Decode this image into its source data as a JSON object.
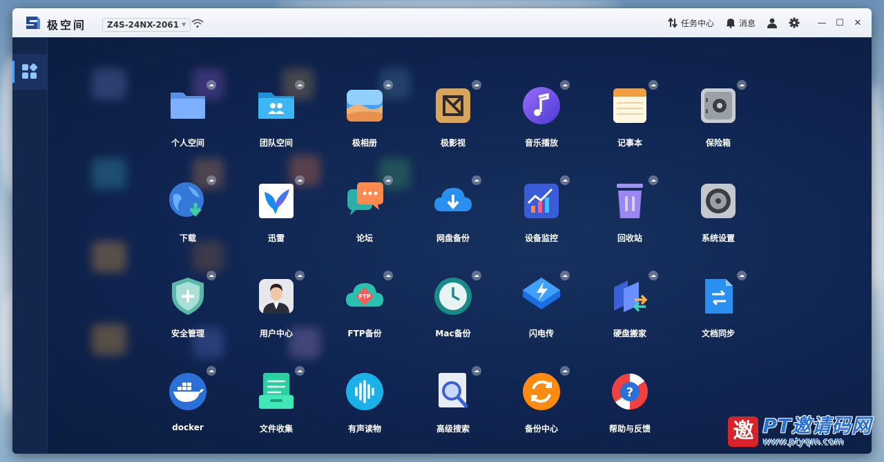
{
  "titlebar": {
    "app_name": "极空间",
    "device": "Z4S-24NX-2061",
    "task_center": "任务中心",
    "messages": "消息",
    "minimize": "—",
    "maximize": "☐",
    "close": "✕"
  },
  "apps": [
    {
      "label": "个人空间",
      "icon": "folder-icon"
    },
    {
      "label": "团队空间",
      "icon": "team-folder-icon"
    },
    {
      "label": "极相册",
      "icon": "photo-album-icon"
    },
    {
      "label": "极影视",
      "icon": "video-icon"
    },
    {
      "label": "音乐播放",
      "icon": "music-icon"
    },
    {
      "label": "记事本",
      "icon": "notepad-icon"
    },
    {
      "label": "保险箱",
      "icon": "safe-icon"
    },
    {
      "label": "下载",
      "icon": "download-icon"
    },
    {
      "label": "迅雷",
      "icon": "thunder-bird-icon"
    },
    {
      "label": "论坛",
      "icon": "forum-icon"
    },
    {
      "label": "网盘备份",
      "icon": "cloud-backup-icon"
    },
    {
      "label": "设备监控",
      "icon": "monitor-chart-icon"
    },
    {
      "label": "回收站",
      "icon": "trash-icon"
    },
    {
      "label": "系统设置",
      "icon": "settings-gear-icon"
    },
    {
      "label": "安全管理",
      "icon": "shield-icon"
    },
    {
      "label": "用户中心",
      "icon": "user-avatar-icon"
    },
    {
      "label": "FTP备份",
      "icon": "ftp-icon"
    },
    {
      "label": "Mac备份",
      "icon": "time-machine-icon"
    },
    {
      "label": "闪电传",
      "icon": "lightning-icon"
    },
    {
      "label": "硬盘搬家",
      "icon": "disk-move-icon"
    },
    {
      "label": "文档同步",
      "icon": "doc-sync-icon"
    },
    {
      "label": "docker",
      "icon": "docker-whale-icon"
    },
    {
      "label": "文件收集",
      "icon": "file-collect-icon"
    },
    {
      "label": "有声读物",
      "icon": "audiobook-icon"
    },
    {
      "label": "高级搜索",
      "icon": "advanced-search-icon"
    },
    {
      "label": "备份中心",
      "icon": "backup-center-icon"
    },
    {
      "label": "帮助与反馈",
      "icon": "help-lifebuoy-icon"
    }
  ],
  "watermark": {
    "seal": "邀",
    "title": "PT邀请码网",
    "url": "www.ptyqm.com"
  }
}
